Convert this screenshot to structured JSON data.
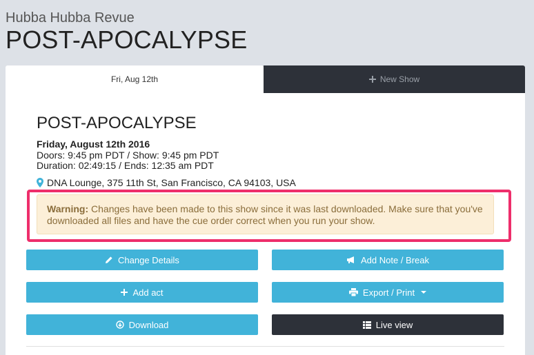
{
  "header": {
    "org_name": "Hubba Hubba Revue",
    "show_name": "POST-APOCALYPSE"
  },
  "tabs": [
    {
      "label": "Fri, Aug 12th",
      "active": true
    },
    {
      "label": "New Show",
      "active": false
    }
  ],
  "show": {
    "title": "POST-APOCALYPSE",
    "date": "Friday, August 12th 2016",
    "doors_show": "Doors: 9:45 pm PDT / Show: 9:45 pm PDT",
    "duration_ends": "Duration: 02:49:15 / Ends: 12:35 am PDT",
    "venue": "DNA Lounge, 375 11th St, San Francisco, CA 94103, USA"
  },
  "warning": {
    "label": "Warning:",
    "message": " Changes have been made to this show since it was last downloaded. Make sure that you've downloaded all files and have the cue order correct when you run your show."
  },
  "buttons": {
    "change_details": "Change Details",
    "add_note_break": "Add Note / Break",
    "add_act": "Add act",
    "export_print": "Export / Print",
    "download": "Download",
    "live_view": "Live view"
  },
  "colors": {
    "accent": "#41b3d9",
    "dark": "#2d3139",
    "highlight": "#ee2e6b",
    "warning_bg": "#fcefd8",
    "warning_text": "#8a6d3b"
  },
  "icons": {
    "change_details": "pencil-icon",
    "add_note_break": "bullhorn-icon",
    "add_act": "plus-icon",
    "export_print": "printer-icon",
    "download": "download-circle-icon",
    "live_view": "list-icon",
    "venue": "map-pin-icon"
  }
}
